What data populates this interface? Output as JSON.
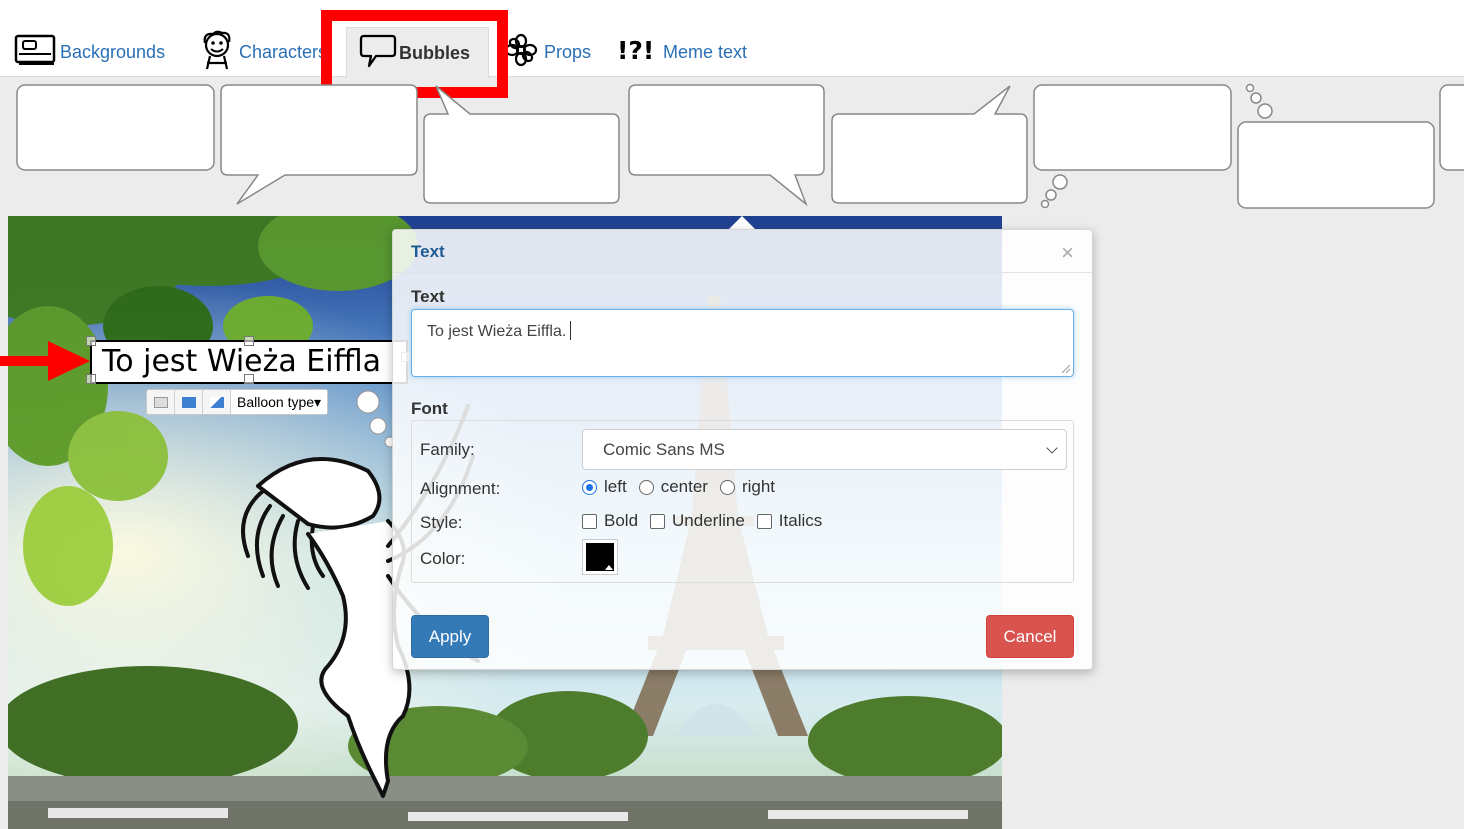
{
  "tabs": [
    {
      "label": "Backgrounds",
      "icon": "background-icon",
      "active": false
    },
    {
      "label": "Characters",
      "icon": "character-icon",
      "active": false
    },
    {
      "label": "Bubbles",
      "icon": "speech-bubble-icon",
      "active": true
    },
    {
      "label": "Props",
      "icon": "flower-icon",
      "active": false
    },
    {
      "label": "Meme text",
      "icon": "exclamation-question-icon",
      "active": false
    }
  ],
  "canvas": {
    "balloon_text": "To jest Wieża Eiffla",
    "balloon_type_label": "Balloon type▾"
  },
  "modal": {
    "title": "Text",
    "close_symbol": "×",
    "text_label": "Text",
    "text_value": "To jest Wieża Eiffla.",
    "font_label": "Font",
    "family_label": "Family:",
    "family_value": "Comic Sans MS",
    "alignment_label": "Alignment:",
    "alignment_options": [
      "left",
      "center",
      "right"
    ],
    "alignment_selected": "left",
    "style_label": "Style:",
    "style_options": [
      "Bold",
      "Underline",
      "Italics"
    ],
    "color_label": "Color:",
    "color_value": "#000000",
    "apply_label": "Apply",
    "cancel_label": "Cancel"
  },
  "colors": {
    "link": "#2a6fb5",
    "highlight": "#ff0000",
    "apply": "#337ab7",
    "cancel": "#d9534f",
    "title": "#1f5a93"
  }
}
